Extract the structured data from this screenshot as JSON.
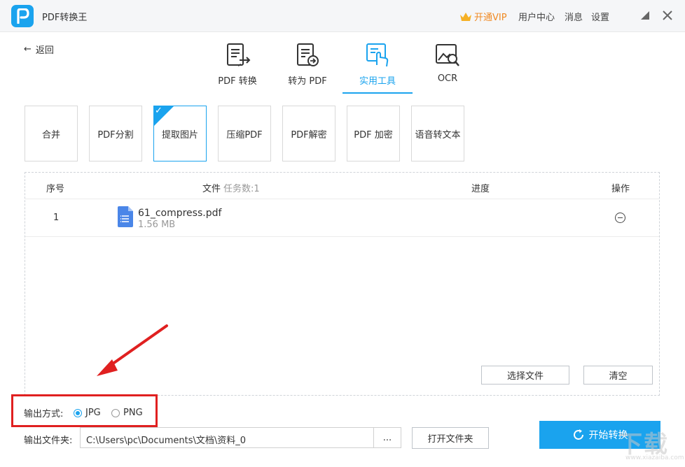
{
  "app": {
    "title": "PDF转换王",
    "vip_label": "开通VIP",
    "user_center": "用户中心",
    "messages": "消息",
    "settings": "设置"
  },
  "nav": {
    "back_label": "返回"
  },
  "tabs": [
    {
      "label": "PDF 转换",
      "icon": "pdf-convert-icon"
    },
    {
      "label": "转为 PDF",
      "icon": "to-pdf-icon"
    },
    {
      "label": "实用工具",
      "icon": "tools-icon",
      "active": true
    },
    {
      "label": "OCR",
      "icon": "ocr-icon"
    }
  ],
  "tools": [
    {
      "label": "合并"
    },
    {
      "label": "PDF分割"
    },
    {
      "label": "提取图片",
      "selected": true
    },
    {
      "label": "压缩PDF"
    },
    {
      "label": "PDF解密"
    },
    {
      "label": "PDF 加密"
    },
    {
      "label": "语音转文本"
    }
  ],
  "table": {
    "headers": {
      "index": "序号",
      "file": "文件",
      "task_count": "任务数:1",
      "progress": "进度",
      "action": "操作"
    },
    "rows": [
      {
        "index": "1",
        "name": "61_compress.pdf",
        "size": "1.56 MB"
      }
    ]
  },
  "actions": {
    "select_files": "选择文件",
    "clear": "清空"
  },
  "output": {
    "mode_label": "输出方式:",
    "options": [
      {
        "label": "JPG",
        "checked": true
      },
      {
        "label": "PNG",
        "checked": false
      }
    ],
    "folder_label": "输出文件夹:",
    "folder_path": "C:\\Users\\pc\\Documents\\文档\\资料_0",
    "browse_label": "...",
    "open_folder": "打开文件夹",
    "start_label": "开始转换"
  },
  "colors": {
    "accent": "#1aa3ee",
    "vip": "#f08a24",
    "annotation": "#e02020"
  },
  "watermark": {
    "text": "下载",
    "sub": "www.xiazaiba.com"
  }
}
